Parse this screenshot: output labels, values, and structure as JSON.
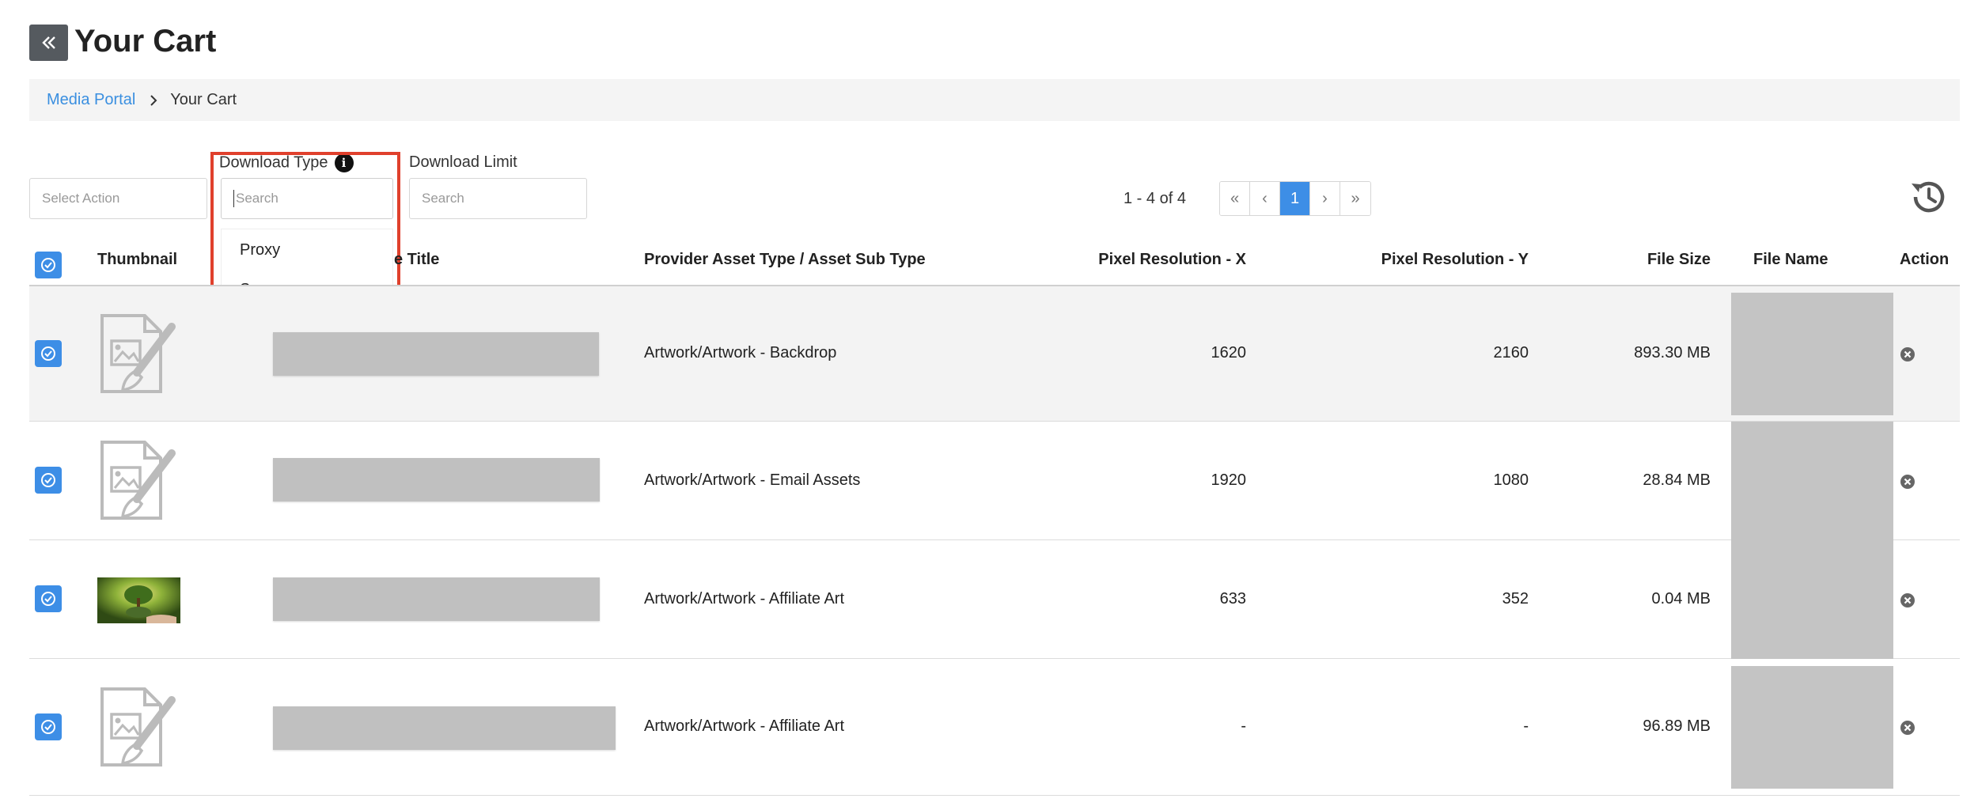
{
  "header": {
    "title": "Your Cart",
    "back_icon": "double-chevron-left-icon"
  },
  "breadcrumb": {
    "link": "Media Portal",
    "current": "Your Cart"
  },
  "filters": {
    "action_placeholder": "Select Action",
    "download_type_label": "Download Type",
    "download_type_placeholder": "Search",
    "download_type_options": [
      "Proxy",
      "Source"
    ],
    "download_limit_label": "Download Limit",
    "download_limit_placeholder": "Search"
  },
  "pagination": {
    "summary": "1 - 4 of 4",
    "first": "«",
    "prev": "‹",
    "current": "1",
    "next": "›",
    "last": "»"
  },
  "table": {
    "columns": {
      "thumbnail": "Thumbnail",
      "title_partial": "e Title",
      "asset_type": "Provider Asset Type / Asset Sub Type",
      "res_x": "Pixel Resolution - X",
      "res_y": "Pixel Resolution - Y",
      "file_size": "File Size",
      "file_name": "File Name",
      "action": "Action"
    },
    "rows": [
      {
        "asset_type": "Artwork/Artwork - Backdrop",
        "res_x": "1620",
        "res_y": "2160",
        "file_size": "893.30 MB",
        "thumb": "placeholder"
      },
      {
        "asset_type": "Artwork/Artwork - Email Assets",
        "res_x": "1920",
        "res_y": "1080",
        "file_size": "28.84 MB",
        "thumb": "placeholder"
      },
      {
        "asset_type": "Artwork/Artwork - Affiliate Art",
        "res_x": "633",
        "res_y": "352",
        "file_size": "0.04 MB",
        "thumb": "photo"
      },
      {
        "asset_type": "Artwork/Artwork - Affiliate Art",
        "res_x": "-",
        "res_y": "-",
        "file_size": "96.89 MB",
        "thumb": "placeholder"
      }
    ]
  },
  "colors": {
    "accent": "#3d8ee6",
    "highlight": "#e0402c",
    "redacted": "#c0c0c0"
  }
}
